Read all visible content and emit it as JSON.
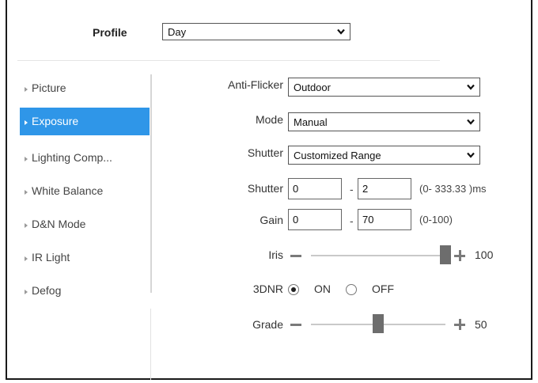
{
  "profile": {
    "label": "Profile",
    "value": "Day"
  },
  "sidebar": {
    "items": [
      {
        "label": "Picture",
        "active": false
      },
      {
        "label": "Exposure",
        "active": true
      },
      {
        "label": "Lighting Comp...",
        "active": false
      },
      {
        "label": "White Balance",
        "active": false
      },
      {
        "label": "D&N Mode",
        "active": false
      },
      {
        "label": "IR Light",
        "active": false
      },
      {
        "label": "Defog",
        "active": false
      }
    ]
  },
  "exposure": {
    "anti_flicker": {
      "label": "Anti-Flicker",
      "value": "Outdoor"
    },
    "mode": {
      "label": "Mode",
      "value": "Manual"
    },
    "shutter_mode": {
      "label": "Shutter",
      "value": "Customized Range"
    },
    "shutter_range": {
      "label": "Shutter",
      "min": "0",
      "dash": "-",
      "max": "2",
      "hint": "(0- 333.33 )ms"
    },
    "gain_range": {
      "label": "Gain",
      "min": "0",
      "dash": "-",
      "max": "70",
      "hint": "(0-100)"
    },
    "iris": {
      "label": "Iris",
      "value": "100",
      "level": 1.0
    },
    "dnr": {
      "label": "3DNR",
      "on_label": "ON",
      "off_label": "OFF",
      "selected": "ON"
    },
    "grade": {
      "label": "Grade",
      "value": "50",
      "level": 0.5
    }
  },
  "colors": {
    "accent": "#2f96e8",
    "slider_thumb": "#6d6d6d",
    "track": "#c9c9c9"
  },
  "icons": {
    "dropdown": "chevron-down-icon",
    "sidebar_bullet": "caret-right-icon",
    "slider_minus": "minus-icon",
    "slider_plus": "plus-icon"
  }
}
